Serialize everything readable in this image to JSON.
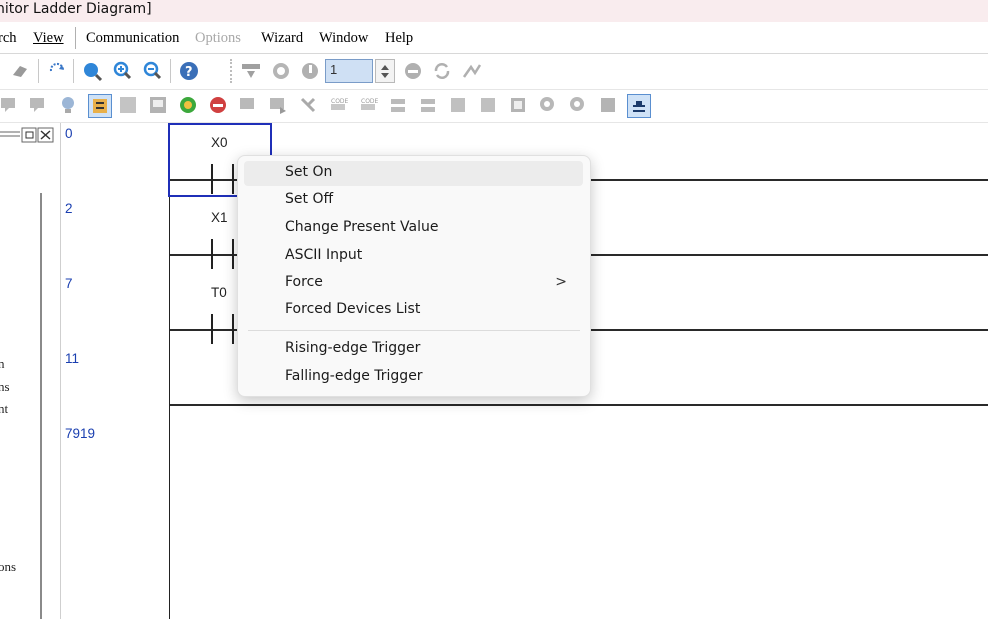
{
  "window": {
    "title": "nitor Ladder Diagram]"
  },
  "menu": {
    "items": [
      {
        "label": "rch",
        "enabled": true
      },
      {
        "label": "View",
        "enabled": true
      },
      {
        "label": "Communication",
        "enabled": true
      },
      {
        "label": "Options",
        "enabled": false
      },
      {
        "label": "Wizard",
        "enabled": true
      },
      {
        "label": "Window",
        "enabled": true
      },
      {
        "label": "Help",
        "enabled": true
      }
    ]
  },
  "toolbar": {
    "stepper_value": "1",
    "icons_row1": [
      "eraser-icon",
      "refresh-arrow-icon",
      "zoom-fit-icon",
      "zoom-in-icon",
      "zoom-out-icon",
      "help-icon",
      "download-icon",
      "upload-icon",
      "run-icon",
      "stop-icon",
      "sync-icon",
      "monitor-arrow-icon"
    ],
    "icons_row2": [
      "comment-icon",
      "comment-edit-icon",
      "bulb-icon",
      "ladder-mode-icon",
      "grid-icon",
      "table-icon",
      "start-icon",
      "stop-circle-icon",
      "write-icon",
      "export-icon",
      "antenna-icon",
      "code-icon",
      "code2-icon",
      "branch-icon",
      "branch2-icon",
      "register-icon",
      "register2-icon",
      "link-icon",
      "device-icon",
      "query-icon",
      "query2-icon",
      "print-icon",
      "ladder-monitor-icon"
    ]
  },
  "left_panel": {
    "texts": [
      "n",
      "ns",
      "nt",
      "ons"
    ]
  },
  "ladder": {
    "steps": [
      "0",
      "2",
      "7",
      "11",
      "7919"
    ],
    "contacts": [
      "X0",
      "X1",
      "T0"
    ]
  },
  "context_menu": {
    "items": [
      {
        "label": "Set On",
        "highlighted": true
      },
      {
        "label": "Set Off"
      },
      {
        "label": "Change Present Value"
      },
      {
        "label": "ASCII Input"
      },
      {
        "label": "Force",
        "submenu": true
      },
      {
        "label": "Forced Devices List"
      },
      {
        "label": "Rising-edge Trigger"
      },
      {
        "label": "Falling-edge Trigger"
      }
    ],
    "submenu_arrow": ">"
  },
  "colors": {
    "step_number": "#1a3fb0",
    "cursor": "#1f2fb8",
    "title_bg": "#f9ecee"
  }
}
